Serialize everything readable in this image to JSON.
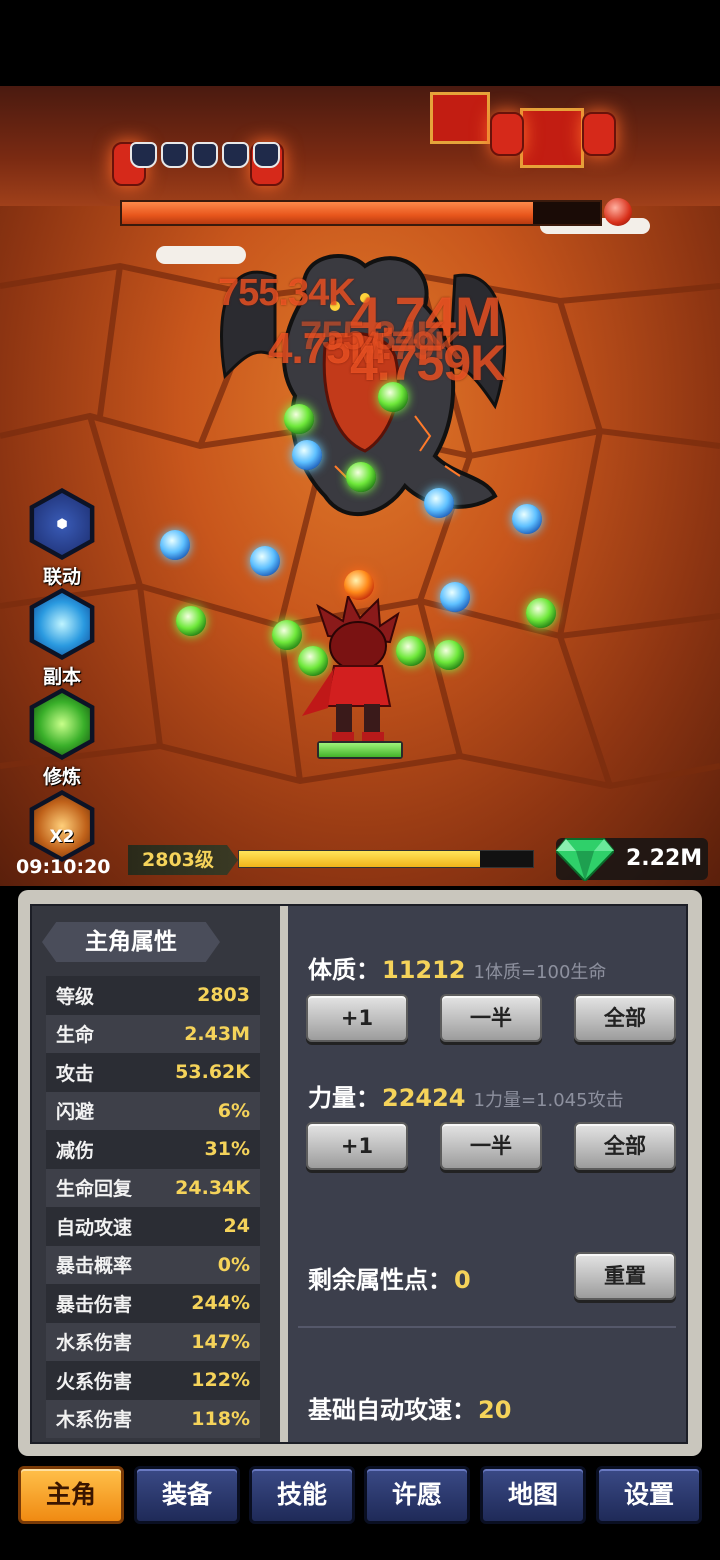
{
  "battle": {
    "damage_numbers": [
      "755.34K",
      "4.74M",
      "4.75M",
      "755.34K",
      "4.79K",
      "4.759K"
    ],
    "boss_hp_fraction": 0.86,
    "hero_hp_fraction": 1.0
  },
  "side_buttons": [
    {
      "label": "联动",
      "icon": "link-event-icon"
    },
    {
      "label": "副本",
      "icon": "vortex-dungeon-icon"
    },
    {
      "label": "修炼",
      "icon": "cultivation-icon"
    },
    {
      "label": "X2",
      "icon": "double-reward-icon"
    }
  ],
  "timer": "09:10:20",
  "level_label": "2803级",
  "exp_fraction": 0.82,
  "gems": "2.22M",
  "stats_panel": {
    "title": "主角属性",
    "rows": [
      {
        "k": "等级",
        "v": "2803"
      },
      {
        "k": "生命",
        "v": "2.43M"
      },
      {
        "k": "攻击",
        "v": "53.62K"
      },
      {
        "k": "闪避",
        "v": "6%"
      },
      {
        "k": "减伤",
        "v": "31%"
      },
      {
        "k": "生命回复",
        "v": "24.34K"
      },
      {
        "k": "自动攻速",
        "v": "24"
      },
      {
        "k": "暴击概率",
        "v": "0%"
      },
      {
        "k": "暴击伤害",
        "v": "244%"
      },
      {
        "k": "水系伤害",
        "v": "147%"
      },
      {
        "k": "火系伤害",
        "v": "122%"
      },
      {
        "k": "木系伤害",
        "v": "118%"
      }
    ]
  },
  "attributes": {
    "constitution": {
      "name": "体质：",
      "value": "11212",
      "hint": "1体质=100生命"
    },
    "strength": {
      "name": "力量：",
      "value": "22424",
      "hint": "1力量=1.045攻击"
    },
    "buttons": {
      "plus_one": "+1",
      "half": "一半",
      "all": "全部"
    },
    "remaining_label": "剩余属性点：",
    "remaining_value": "0",
    "reset": "重置",
    "base_speed_label": "基础自动攻速：",
    "base_speed_value": "20"
  },
  "tabs": [
    "主角",
    "装备",
    "技能",
    "许愿",
    "地图",
    "设置"
  ],
  "colors": {
    "accent_gold": "#f5d35a",
    "tab_active": "#f5a623",
    "tab_blue": "#2a3670",
    "boss_bar": "#e8561c",
    "hero_hp": "#5cd13a"
  }
}
